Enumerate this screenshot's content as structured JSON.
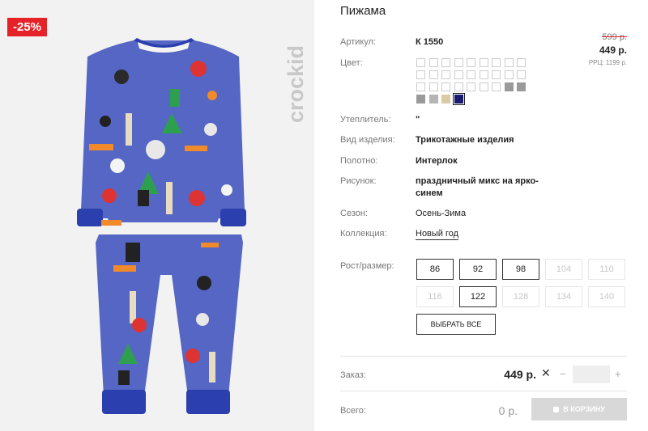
{
  "product": {
    "title": "Пижама",
    "discount_badge": "-25%",
    "brand_logo_text": "crockid",
    "price_old": "599 р.",
    "price_new": "449 р.",
    "rrc": "РРЦ: 1199 р."
  },
  "specs": {
    "article_label": "Артикул:",
    "article_value": "К 1550",
    "color_label": "Цвет:",
    "insulation_label": "Утеплитель:",
    "insulation_value": "\"",
    "type_label": "Вид изделия:",
    "type_value": "Трикотажные изделия",
    "fabric_label": "Полотно:",
    "fabric_value": "Интерлок",
    "pattern_label": "Рисунок:",
    "pattern_line1": "праздничный микс на ярко-",
    "pattern_line2": "синем",
    "season_label": "Сезон:",
    "season_value": "Осень-Зима",
    "collection_label": "Коллекция:",
    "collection_value": "Новый год"
  },
  "colors": {
    "swatches": [
      "#ffffff",
      "#ffffff",
      "#ffffff",
      "#ffffff",
      "#ffffff",
      "#ffffff",
      "#ffffff",
      "#ffffff",
      "#ffffff",
      "#ffffff",
      "#ffffff",
      "#ffffff",
      "#ffffff",
      "#ffffff",
      "#ffffff",
      "#ffffff",
      "#ffffff",
      "#ffffff",
      "#ffffff",
      "#ffffff",
      "#ffffff",
      "#ffffff",
      "#ffffff",
      "#ffffff",
      "#ffffff",
      "#9a9a9a",
      "#9a9a9a",
      "#9a9a9a",
      "#b5b5b5",
      "#d9cba6",
      "#1a1a6e"
    ],
    "selected": "#1a1a6e"
  },
  "sizes": {
    "label": "Рост/размер:",
    "items": [
      {
        "label": "86",
        "available": true
      },
      {
        "label": "92",
        "available": true
      },
      {
        "label": "98",
        "available": true
      },
      {
        "label": "104",
        "available": false
      },
      {
        "label": "110",
        "available": false
      },
      {
        "label": "116",
        "available": false
      },
      {
        "label": "122",
        "available": true
      },
      {
        "label": "128",
        "available": false
      },
      {
        "label": "134",
        "available": false
      },
      {
        "label": "140",
        "available": false
      }
    ],
    "select_all": "ВЫБРАТЬ ВСЕ"
  },
  "order": {
    "label": "Заказ:",
    "price": "449 р.",
    "times": "✕",
    "minus": "−",
    "plus": "+",
    "qty": ""
  },
  "total": {
    "label": "Всего:",
    "value": "0 р.",
    "cart_button": "В КОРЗИНУ"
  }
}
